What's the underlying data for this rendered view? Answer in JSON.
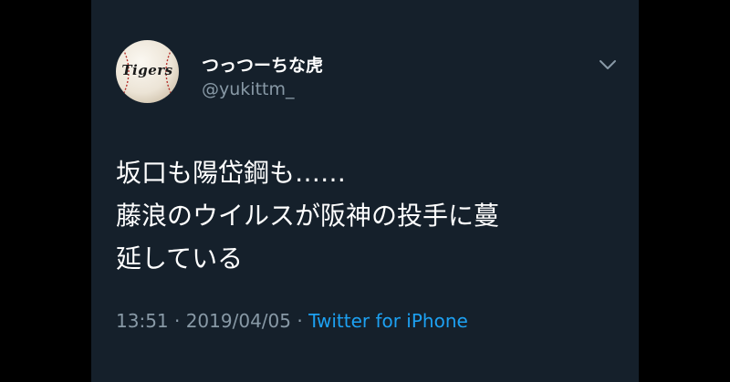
{
  "tweet": {
    "display_name": "つっつーちな虎",
    "handle": "@yukittm_",
    "avatar_text": "Tigers",
    "body_lines": [
      "坂口も陽岱鋼も……",
      "藤浪のウイルスが阪神の投手に蔓",
      "延している"
    ],
    "timestamp": "13:51 · 2019/04/05 · ",
    "source": "Twitter for iPhone"
  },
  "icons": {
    "menu": "chevron-down-icon",
    "avatar": "baseball-icon"
  },
  "colors": {
    "background": "#15202b",
    "page_background": "#000000",
    "text_primary": "#ffffff",
    "text_secondary": "#8899a6",
    "link": "#1da1f2"
  }
}
